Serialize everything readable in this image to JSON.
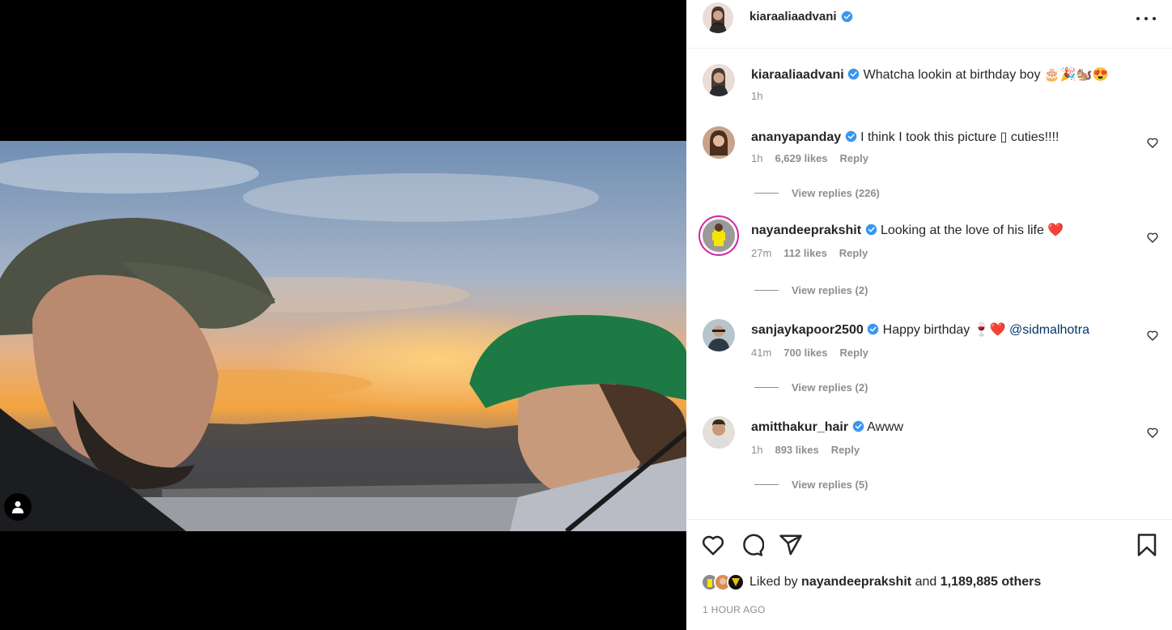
{
  "post": {
    "author": "kiaraaliaadvani",
    "caption": "Whatcha lookin at birthday boy",
    "caption_emojis": "🎂🎉🐿️😍",
    "caption_time": "1h"
  },
  "comments": [
    {
      "user": "ananyapanday",
      "text": "I think I took this picture ▯ cuties!!!!",
      "time": "1h",
      "likes": "6,629 likes",
      "reply": "Reply",
      "view_replies": "View replies (226)"
    },
    {
      "user": "nayandeeprakshit",
      "text": "Looking at the love of his life",
      "emoji": "❤️",
      "time": "27m",
      "likes": "112 likes",
      "reply": "Reply",
      "view_replies": "View replies (2)"
    },
    {
      "user": "sanjaykapoor2500",
      "text": "Happy birthday",
      "emoji": "🍷❤️",
      "mention": "@sidmalhotra",
      "time": "41m",
      "likes": "700 likes",
      "reply": "Reply",
      "view_replies": "View replies (2)"
    },
    {
      "user": "amitthakur_hair",
      "text": "Awww",
      "time": "1h",
      "likes": "893 likes",
      "reply": "Reply",
      "view_replies": "View replies (5)"
    }
  ],
  "likes": {
    "prefix": "Liked by",
    "user": "nayandeeprakshit",
    "and": "and",
    "others": "1,189,885 others"
  },
  "timestamp": "1 HOUR AGO",
  "colors": {
    "verified": "#3897f0",
    "heart_red": "#ed4956",
    "muted": "#8e8e8e",
    "text": "#262626",
    "link": "#00376b"
  },
  "icons": [
    "more-icon",
    "verified-icon",
    "heart-icon",
    "comment-icon",
    "share-icon",
    "bookmark-icon",
    "user-tag-icon"
  ]
}
